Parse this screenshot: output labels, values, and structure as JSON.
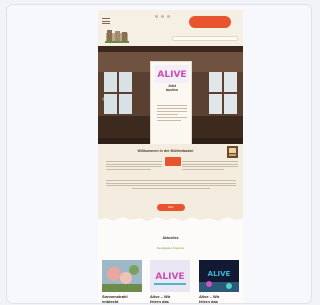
{
  "header": {
    "cta_label": "",
    "search_placeholder": ""
  },
  "hero": {
    "title_line1": "Jetzt",
    "title_line2": "buchen"
  },
  "welcome": {
    "title": "Willkommen in der Mühlenbastei",
    "more_label": "Mehr"
  },
  "news": {
    "title": "Aktuelles",
    "subtitle": "Neuigkeiten & Events",
    "items": [
      {
        "caption_1": "Sonnenstrahl",
        "caption_2": "entdeckt"
      },
      {
        "caption_1": "Alive – Wir",
        "caption_2": "feiern das"
      },
      {
        "caption_1": "Alive – Wir",
        "caption_2": "feiern das"
      }
    ]
  },
  "colors": {
    "accent": "#e8542d",
    "background": "#f4ecdf",
    "green": "#7a9a3a"
  }
}
